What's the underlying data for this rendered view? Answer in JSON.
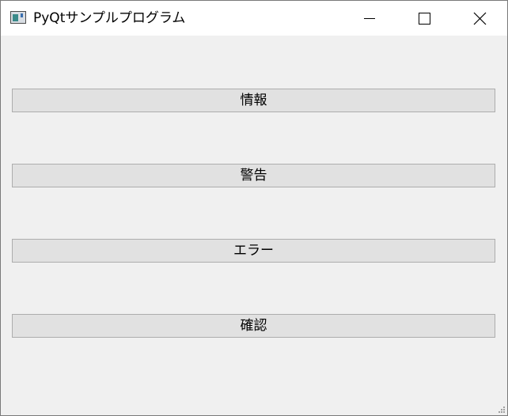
{
  "window": {
    "title": "PyQtサンプルプログラム",
    "icon": "app-window-icon",
    "controls": {
      "minimize_icon": "minimize-icon",
      "maximize_icon": "maximize-icon",
      "close_icon": "close-icon"
    }
  },
  "buttons": [
    {
      "label": "情報"
    },
    {
      "label": "警告"
    },
    {
      "label": "エラー"
    },
    {
      "label": "確認"
    }
  ],
  "colors": {
    "window_background": "#f0f0f0",
    "titlebar_background": "#ffffff",
    "button_background": "#e1e1e1",
    "button_border": "#adadad"
  }
}
